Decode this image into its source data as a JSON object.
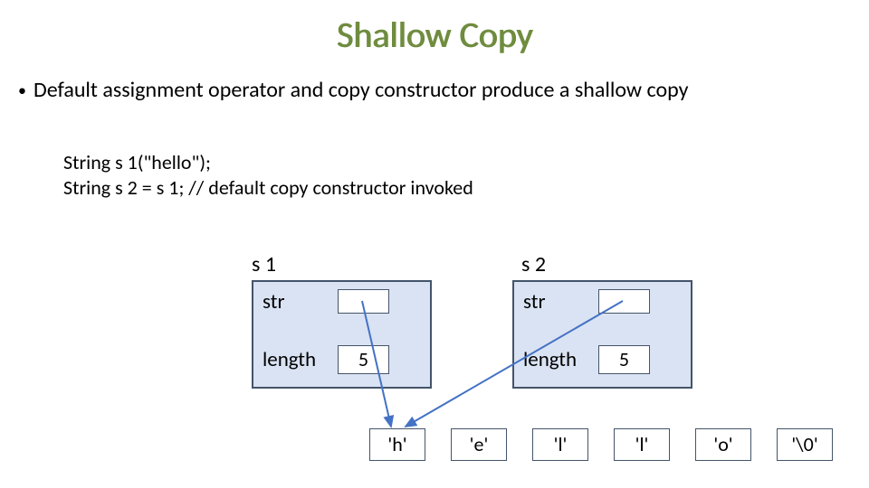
{
  "title": "Shallow Copy",
  "bullet": "Default assignment operator and copy constructor produce a shallow copy",
  "code": {
    "line1": "String s 1(\"hello\");",
    "line2": "String s 2 = s 1;  // default copy constructor invoked"
  },
  "objects": {
    "s1": {
      "name": "s 1",
      "field_str": "str",
      "field_length": "length",
      "length_value": "5"
    },
    "s2": {
      "name": "s 2",
      "field_str": "str",
      "field_length": "length",
      "length_value": "5"
    }
  },
  "chars": [
    "'h'",
    "'e'",
    "'l'",
    "'l'",
    "'o'",
    "'\\0'"
  ]
}
